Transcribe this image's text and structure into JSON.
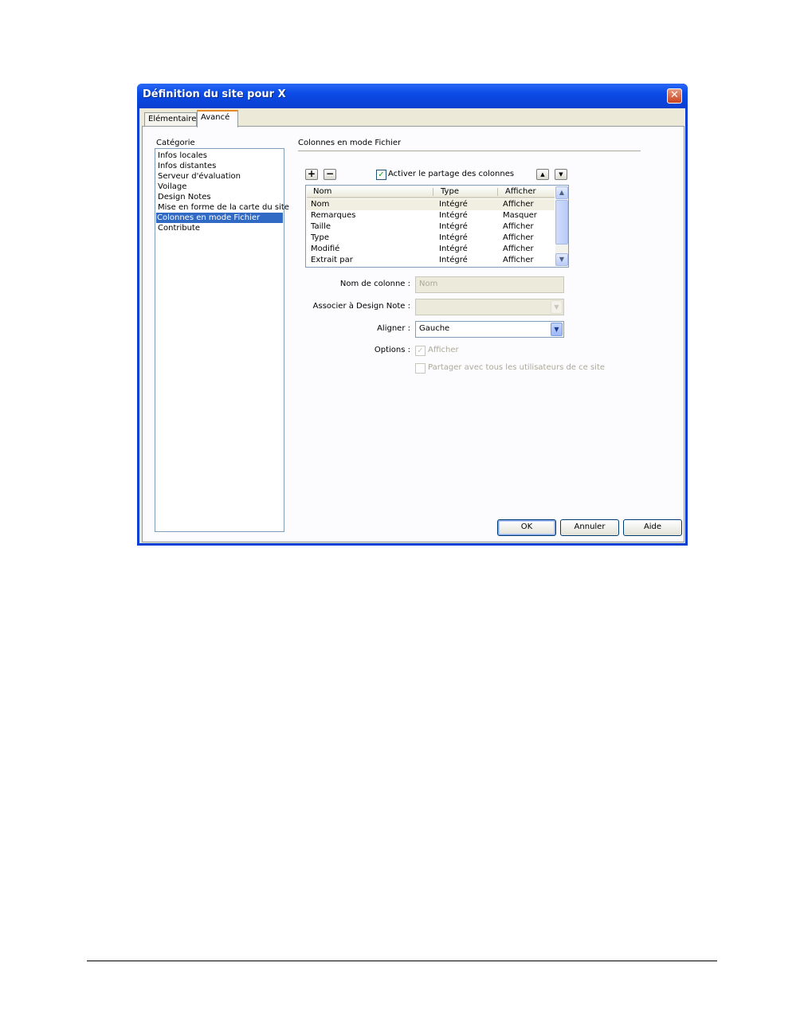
{
  "window": {
    "title": "Définition du site pour X",
    "close_glyph": "✕"
  },
  "tabs": [
    {
      "label": "Elémentaire",
      "active": false
    },
    {
      "label": "Avancé",
      "active": true
    }
  ],
  "category": {
    "label": "Catégorie",
    "items": [
      "Infos locales",
      "Infos distantes",
      "Serveur d'évaluation",
      "Voilage",
      "Design Notes",
      "Mise en forme de la carte du site",
      "Colonnes en mode Fichier",
      "Contribute"
    ],
    "selected_index": 6
  },
  "panel": {
    "heading": "Colonnes en mode Fichier",
    "add_icon": "plus-icon",
    "remove_icon": "minus-icon",
    "enable_sharing": {
      "label": "Activer le partage des colonnes",
      "checked": true
    },
    "move_up_icon": "arrow-up-icon",
    "move_down_icon": "arrow-down-icon"
  },
  "columns_table": {
    "headers": [
      "Nom",
      "Type",
      "Afficher"
    ],
    "rows": [
      {
        "nom": "Nom",
        "type": "Intégré",
        "afficher": "Afficher"
      },
      {
        "nom": "Remarques",
        "type": "Intégré",
        "afficher": "Masquer"
      },
      {
        "nom": "Taille",
        "type": "Intégré",
        "afficher": "Afficher"
      },
      {
        "nom": "Type",
        "type": "Intégré",
        "afficher": "Afficher"
      },
      {
        "nom": "Modifié",
        "type": "Intégré",
        "afficher": "Afficher"
      },
      {
        "nom": "Extrait par",
        "type": "Intégré",
        "afficher": "Afficher"
      }
    ],
    "selected_row": 0
  },
  "form": {
    "column_name": {
      "label": "Nom de colonne :",
      "value": "Nom",
      "enabled": false
    },
    "design_note": {
      "label": "Associer à Design Note :",
      "value": "",
      "enabled": false
    },
    "align": {
      "label": "Aligner :",
      "value": "Gauche",
      "enabled": true
    },
    "options": {
      "label": "Options :",
      "show": {
        "label": "Afficher",
        "checked": true,
        "enabled": false
      },
      "share": {
        "label": "Partager avec tous les utilisateurs de ce site",
        "checked": false,
        "enabled": false
      }
    }
  },
  "buttons": {
    "ok": "OK",
    "cancel": "Annuler",
    "help": "Aide"
  },
  "colors": {
    "titlebar": "#0b4be6",
    "selection": "#316ac5",
    "dialog_bg": "#ece9d8",
    "close_button": "#c9421f",
    "tab_highlight": "#e68b2c"
  }
}
